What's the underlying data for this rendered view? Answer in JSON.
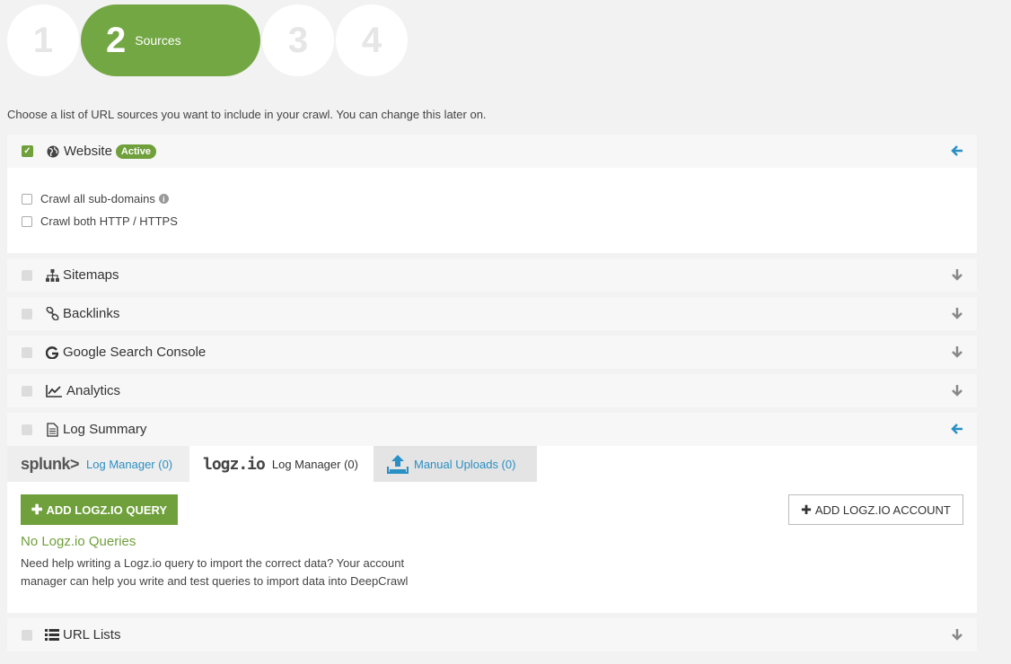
{
  "steps": {
    "step1": "1",
    "step2_num": "2",
    "step2_label": "Sources",
    "step3": "3",
    "step4": "4"
  },
  "intro": "Choose a list of URL sources you want to include in your crawl. You can change this later on.",
  "website": {
    "label": "Website",
    "badge": "Active",
    "opt_subdomains": "Crawl all sub-domains",
    "opt_http": "Crawl both HTTP / HTTPS"
  },
  "sources": {
    "sitemaps": "Sitemaps",
    "backlinks": "Backlinks",
    "gsc": "Google Search Console",
    "analytics": "Analytics",
    "log_summary": "Log Summary",
    "url_lists": "URL Lists"
  },
  "tabs": {
    "splunk_logo": "splunk>",
    "splunk_label": "Log Manager (0)",
    "logz_logo": "logz.io",
    "logz_label": "Log Manager (0)",
    "manual_label": "Manual Uploads (0)"
  },
  "logz": {
    "add_query": "ADD LOGZ.IO QUERY",
    "add_account": "ADD LOGZ.IO ACCOUNT",
    "no_queries": "No Logz.io Queries",
    "help": "Need help writing a Logz.io query to import the correct data? Your account manager can help you write and test queries to import data into DeepCrawl"
  },
  "colors": {
    "accent": "#73a744",
    "link": "#2a8fc4"
  }
}
